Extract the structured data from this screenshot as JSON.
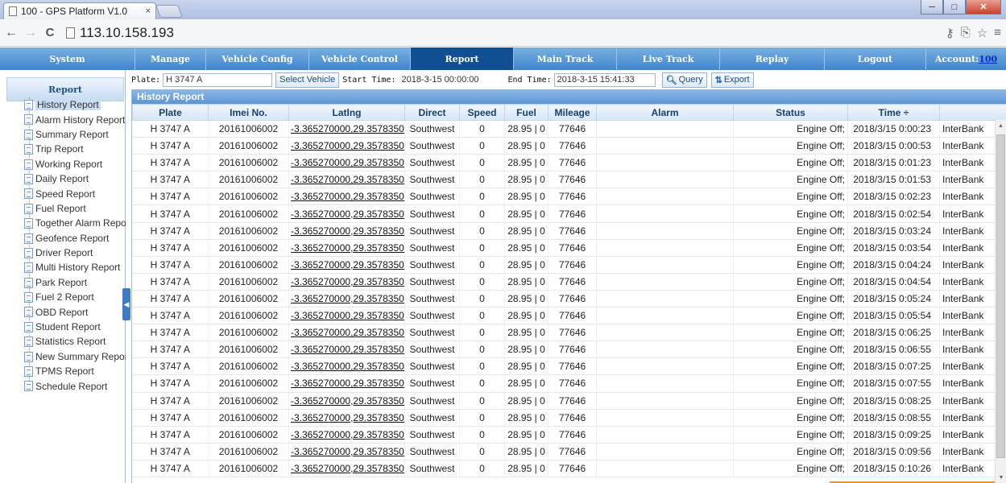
{
  "browser": {
    "tab_title": "100 - GPS Platform V1.0",
    "tab_close": "×",
    "url": "113.10.158.193",
    "back": "←",
    "forward": "→",
    "reload": "C",
    "right_icons": [
      "key-icon",
      "translate-icon",
      "star-icon",
      "menu-icon"
    ],
    "window_buttons": {
      "minimize": "─",
      "maximize": "□",
      "close": "✕"
    }
  },
  "nav": {
    "system": "System",
    "manage": "Manage",
    "vehicle_config": "Vehicle Config",
    "vehicle_control": "Vehicle Control",
    "report": "Report",
    "main_track": "Main Track",
    "live_track": "Live Track",
    "replay": "Replay",
    "logout": "Logout",
    "account_label": "Account:",
    "account_value": "100"
  },
  "sidebar": {
    "header": "Report",
    "items": [
      "History Report",
      "Alarm History Report",
      "Summary Report",
      "Trip Report",
      "Working Report",
      "Daily Report",
      "Speed Report",
      "Fuel Report",
      "Together Alarm Report",
      "Geofence Report",
      "Driver Report",
      "Multi History Report",
      "Park Report",
      "Fuel 2 Report",
      "OBD Report",
      "Student Report",
      "Statistics Report",
      "New Summary Report",
      "TPMS Report",
      "Schedule Report"
    ],
    "selected_index": 0
  },
  "filters": {
    "plate_label": "Plate:",
    "plate_value": "H 3747 A",
    "select_vehicle": "Select Vehicle",
    "start_label": "Start Time:",
    "start_value": "2018-3-15 00:00:00",
    "end_label": "End Time:",
    "end_value": "2018-3-15 15:41:33",
    "query": "Query",
    "export": "Export"
  },
  "report": {
    "title": "History Report",
    "columns": [
      "Plate",
      "Imei No.",
      "Latlng",
      "Direct",
      "Speed",
      "Fuel",
      "Mileage",
      "Alarm",
      "Status",
      "Time ÷",
      ""
    ],
    "rows": [
      [
        "H 3747 A",
        "20161006002",
        "-3.365270000,29.357835000",
        "Southwest",
        "0",
        "28.95 | 0",
        "77646",
        "",
        "Engine Off;",
        "2018/3/15 0:00:23",
        "InterBank"
      ],
      [
        "H 3747 A",
        "20161006002",
        "-3.365270000,29.357835000",
        "Southwest",
        "0",
        "28.95 | 0",
        "77646",
        "",
        "Engine Off;",
        "2018/3/15 0:00:53",
        "InterBank"
      ],
      [
        "H 3747 A",
        "20161006002",
        "-3.365270000,29.357835000",
        "Southwest",
        "0",
        "28.95 | 0",
        "77646",
        "",
        "Engine Off;",
        "2018/3/15 0:01:23",
        "InterBank"
      ],
      [
        "H 3747 A",
        "20161006002",
        "-3.365270000,29.357835000",
        "Southwest",
        "0",
        "28.95 | 0",
        "77646",
        "",
        "Engine Off;",
        "2018/3/15 0:01:53",
        "InterBank"
      ],
      [
        "H 3747 A",
        "20161006002",
        "-3.365270000,29.357835000",
        "Southwest",
        "0",
        "28.95 | 0",
        "77646",
        "",
        "Engine Off;",
        "2018/3/15 0:02:23",
        "InterBank"
      ],
      [
        "H 3747 A",
        "20161006002",
        "-3.365270000,29.357835000",
        "Southwest",
        "0",
        "28.95 | 0",
        "77646",
        "",
        "Engine Off;",
        "2018/3/15 0:02:54",
        "InterBank"
      ],
      [
        "H 3747 A",
        "20161006002",
        "-3.365270000,29.357835000",
        "Southwest",
        "0",
        "28.95 | 0",
        "77646",
        "",
        "Engine Off;",
        "2018/3/15 0:03:24",
        "InterBank"
      ],
      [
        "H 3747 A",
        "20161006002",
        "-3.365270000,29.357835000",
        "Southwest",
        "0",
        "28.95 | 0",
        "77646",
        "",
        "Engine Off;",
        "2018/3/15 0:03:54",
        "InterBank"
      ],
      [
        "H 3747 A",
        "20161006002",
        "-3.365270000,29.357835000",
        "Southwest",
        "0",
        "28.95 | 0",
        "77646",
        "",
        "Engine Off;",
        "2018/3/15 0:04:24",
        "InterBank"
      ],
      [
        "H 3747 A",
        "20161006002",
        "-3.365270000,29.357835000",
        "Southwest",
        "0",
        "28.95 | 0",
        "77646",
        "",
        "Engine Off;",
        "2018/3/15 0:04:54",
        "InterBank"
      ],
      [
        "H 3747 A",
        "20161006002",
        "-3.365270000,29.357835000",
        "Southwest",
        "0",
        "28.95 | 0",
        "77646",
        "",
        "Engine Off;",
        "2018/3/15 0:05:24",
        "InterBank"
      ],
      [
        "H 3747 A",
        "20161006002",
        "-3.365270000,29.357835000",
        "Southwest",
        "0",
        "28.95 | 0",
        "77646",
        "",
        "Engine Off;",
        "2018/3/15 0:05:54",
        "InterBank"
      ],
      [
        "H 3747 A",
        "20161006002",
        "-3.365270000,29.357835000",
        "Southwest",
        "0",
        "28.95 | 0",
        "77646",
        "",
        "Engine Off;",
        "2018/3/15 0:06:25",
        "InterBank"
      ],
      [
        "H 3747 A",
        "20161006002",
        "-3.365270000,29.357835000",
        "Southwest",
        "0",
        "28.95 | 0",
        "77646",
        "",
        "Engine Off;",
        "2018/3/15 0:06:55",
        "InterBank"
      ],
      [
        "H 3747 A",
        "20161006002",
        "-3.365270000,29.357835000",
        "Southwest",
        "0",
        "28.95 | 0",
        "77646",
        "",
        "Engine Off;",
        "2018/3/15 0:07:25",
        "InterBank"
      ],
      [
        "H 3747 A",
        "20161006002",
        "-3.365270000,29.357835000",
        "Southwest",
        "0",
        "28.95 | 0",
        "77646",
        "",
        "Engine Off;",
        "2018/3/15 0:07:55",
        "InterBank"
      ],
      [
        "H 3747 A",
        "20161006002",
        "-3.365270000,29.357835000",
        "Southwest",
        "0",
        "28.95 | 0",
        "77646",
        "",
        "Engine Off;",
        "2018/3/15 0:08:25",
        "InterBank"
      ],
      [
        "H 3747 A",
        "20161006002",
        "-3.365270000,29.357835000",
        "Southwest",
        "0",
        "28.95 | 0",
        "77646",
        "",
        "Engine Off;",
        "2018/3/15 0:08:55",
        "InterBank"
      ],
      [
        "H 3747 A",
        "20161006002",
        "-3.365270000,29.357835000",
        "Southwest",
        "0",
        "28.95 | 0",
        "77646",
        "",
        "Engine Off;",
        "2018/3/15 0:09:25",
        "InterBank"
      ],
      [
        "H 3747 A",
        "20161006002",
        "-3.365270000,29.357835000",
        "Southwest",
        "0",
        "28.95 | 0",
        "77646",
        "",
        "Engine Off;",
        "2018/3/15 0:09:56",
        "InterBank"
      ],
      [
        "H 3747 A",
        "20161006002",
        "-3.365270000,29.357835000",
        "Southwest",
        "0",
        "28.95 | 0",
        "77646",
        "",
        "Engine Off;",
        "2018/3/15 0:10:26",
        "InterBank"
      ]
    ]
  }
}
